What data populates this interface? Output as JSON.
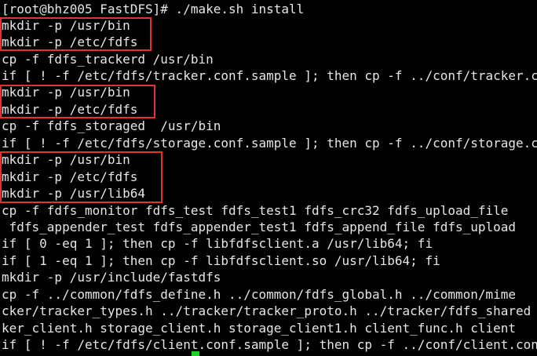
{
  "terminal": {
    "lines": [
      "[root@bhz005 FastDFS]# ./make.sh install",
      "mkdir -p /usr/bin",
      "mkdir -p /etc/fdfs",
      "cp -f fdfs_trackerd /usr/bin",
      "if [ ! -f /etc/fdfs/tracker.conf.sample ]; then cp -f ../conf/tracker.conf /etc/fdfs/tracker.conf.sample; fi",
      "mkdir -p /usr/bin",
      "mkdir -p /etc/fdfs",
      "cp -f fdfs_storaged  /usr/bin",
      "if [ ! -f /etc/fdfs/storage.conf.sample ]; then cp -f ../conf/storage.conf /etc/fdfs/storage.conf.sample; fi",
      "mkdir -p /usr/bin",
      "mkdir -p /etc/fdfs",
      "mkdir -p /usr/lib64",
      "cp -f fdfs_monitor fdfs_test fdfs_test1 fdfs_crc32 fdfs_upload_file",
      " fdfs_appender_test fdfs_appender_test1 fdfs_append_file fdfs_upload",
      "if [ 0 -eq 1 ]; then cp -f libfdfsclient.a /usr/lib64; fi",
      "if [ 1 -eq 1 ]; then cp -f libfdfsclient.so /usr/lib64; fi",
      "mkdir -p /usr/include/fastdfs",
      "cp -f ../common/fdfs_define.h ../common/fdfs_global.h ../common/mime",
      "cker/tracker_types.h ../tracker/tracker_proto.h ../tracker/fdfs_shared",
      "ker_client.h storage_client.h storage_client1.h client_func.h client",
      "if [ ! -f /etc/fdfs/client.conf.sample ]; then cp -f ../conf/client.conf"
    ],
    "colors": {
      "background": "#000000",
      "text": "#e6e6e6",
      "highlight_border": "#e0342c",
      "cursor": "#1fd12b"
    }
  }
}
